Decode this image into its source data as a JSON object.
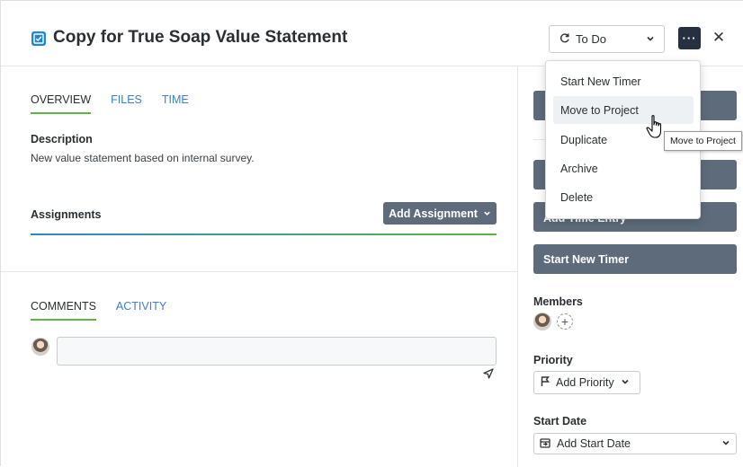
{
  "task": {
    "title": "Copy for True Soap Value Statement",
    "status": "To Do"
  },
  "tabs": [
    "OVERVIEW",
    "FILES",
    "TIME"
  ],
  "description": {
    "heading": "Description",
    "text": "New value statement based on internal survey."
  },
  "assignments": {
    "heading": "Assignments",
    "add_label": "Add Assignment"
  },
  "comment_tabs": [
    "COMMENTS",
    "ACTIVITY"
  ],
  "menu": {
    "items": [
      "Start New Timer",
      "Move to Project",
      "Duplicate",
      "Archive",
      "Delete"
    ],
    "hovered": "Move to Project"
  },
  "tooltip": "Move to Project",
  "sidebar": {
    "add_time_entry": "Add Time Entry",
    "start_timer": "Start New Timer",
    "members_heading": "Members",
    "priority_heading": "Priority",
    "priority_button": "Add Priority",
    "start_date_heading": "Start Date",
    "start_date_button": "Add Start Date"
  },
  "icons": {
    "task": "checkbox-icon",
    "status": "refresh-icon",
    "more": "ellipsis-icon",
    "close": "close-icon",
    "send": "send-icon",
    "priority": "flag-icon",
    "date": "calendar-icon"
  },
  "colors": {
    "accent_green": "#5bb645",
    "accent_blue": "#1f86d8",
    "button_slate": "#5e6b7a",
    "dark_button": "#263040"
  }
}
